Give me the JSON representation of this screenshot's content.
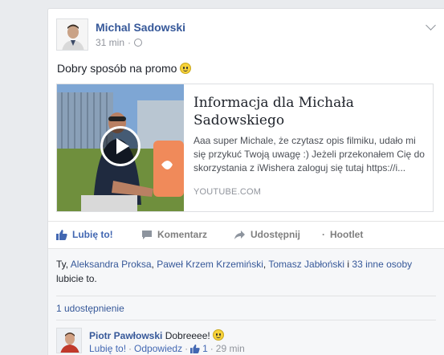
{
  "post": {
    "author": "Michal Sadowski",
    "time": "31 min",
    "separator": "·",
    "text": "Dobry sposób na promo"
  },
  "link_preview": {
    "title": "Informacja dla Michała Sadowskiego",
    "description": "Aaa super Michale, że czytasz opis filmiku, udało mi się przykuć Twoją uwagę :) Jeżeli przekonałem Cię do skorzystania z iWishera zaloguj się tutaj https://i...",
    "source": "YOUTUBE.COM"
  },
  "actions": {
    "like": "Lubię to!",
    "comment": "Komentarz",
    "share": "Udostępnij",
    "hootlet": "Hootlet",
    "hootlet_prefix": "·"
  },
  "likes": {
    "prefix": "Ty, ",
    "names": [
      "Aleksandra Proksa",
      "Paweł Krzem Krzemiński",
      "Tomasz Jabłoński"
    ],
    "sep1": ", ",
    "sep2": ", ",
    "and": " i ",
    "others": "33 inne osoby",
    "suffix": "lubicie to."
  },
  "shares": {
    "label": "1 udostępnienie"
  },
  "comment": {
    "author": "Piotr Pawłowski",
    "text": "Dobreeee!",
    "like": "Lubię to!",
    "reply": "Odpowiedz",
    "like_count": "1",
    "time": "29 min",
    "dot": "·"
  },
  "colors": {
    "link": "#365899",
    "like_active": "#4267b2",
    "meta": "#90949c",
    "background": "#e9ebee"
  }
}
